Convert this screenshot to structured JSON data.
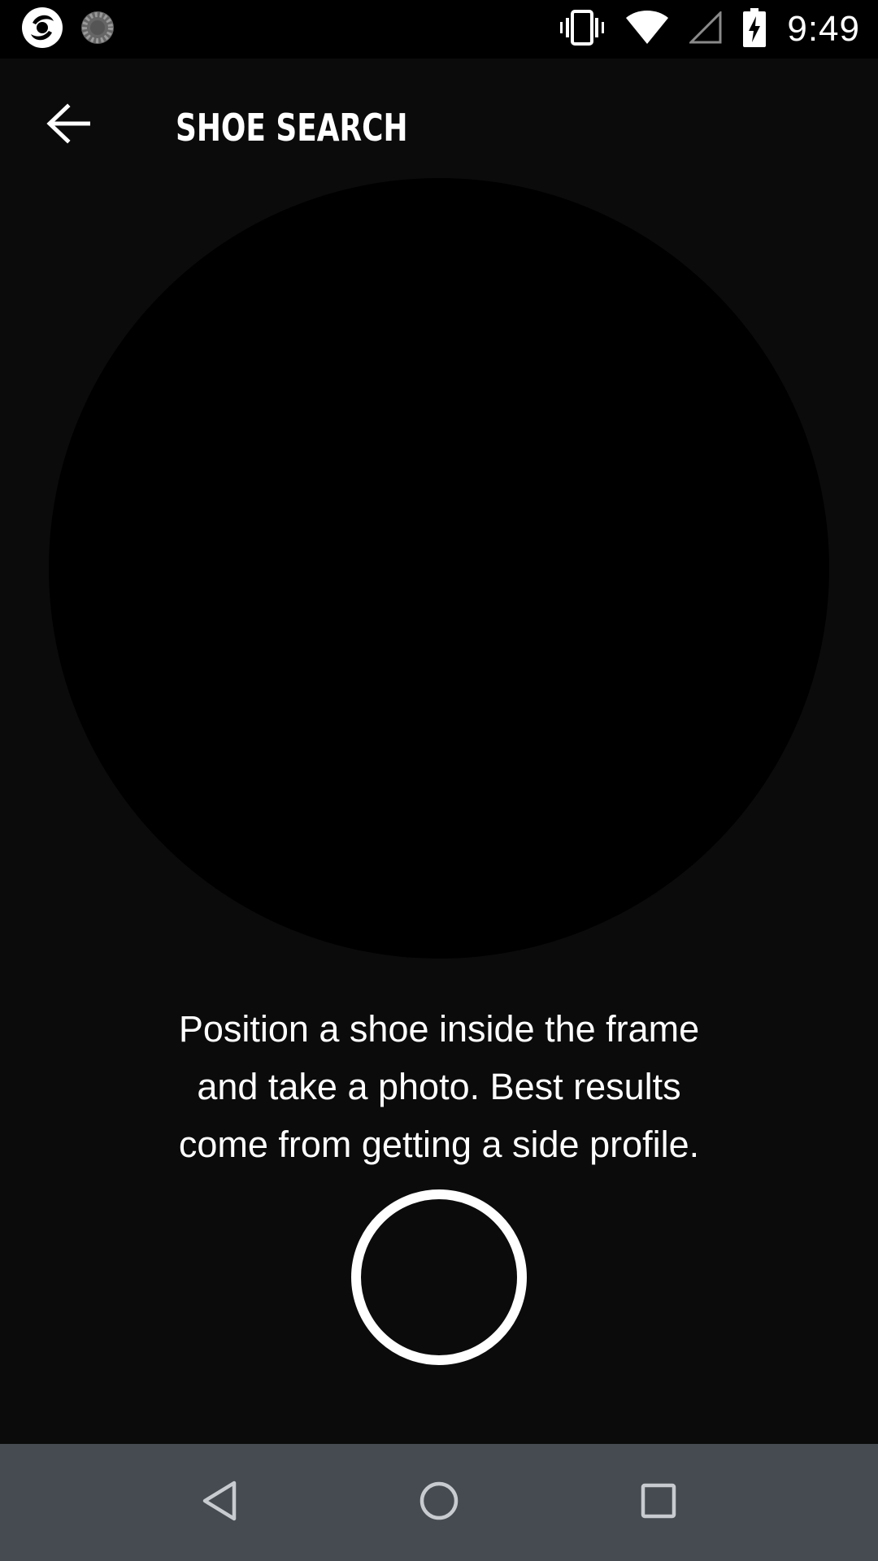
{
  "status_bar": {
    "time": "9:49",
    "left_icons": [
      "app-logo-icon",
      "loading-spinner-icon"
    ],
    "right_icons": [
      "vibrate-icon",
      "wifi-icon",
      "cell-signal-icon",
      "battery-charging-icon"
    ]
  },
  "app_bar": {
    "title": "SHOE SEARCH",
    "back_icon": "arrow-back-icon"
  },
  "instructions": {
    "line1": "Position a shoe inside the frame",
    "line2": "and take a photo. Best results",
    "line3": "come from getting a side profile."
  },
  "shutter": {
    "icon": "shutter-ring-icon"
  },
  "navigation_bar": {
    "items": [
      "nav-back-icon",
      "nav-home-icon",
      "nav-recents-icon"
    ]
  },
  "colors": {
    "background": "#0b0b0b",
    "frame": "#000000",
    "text": "#ffffff",
    "nav_bar": "#454b51",
    "nav_icon": "#c8ccd0"
  }
}
